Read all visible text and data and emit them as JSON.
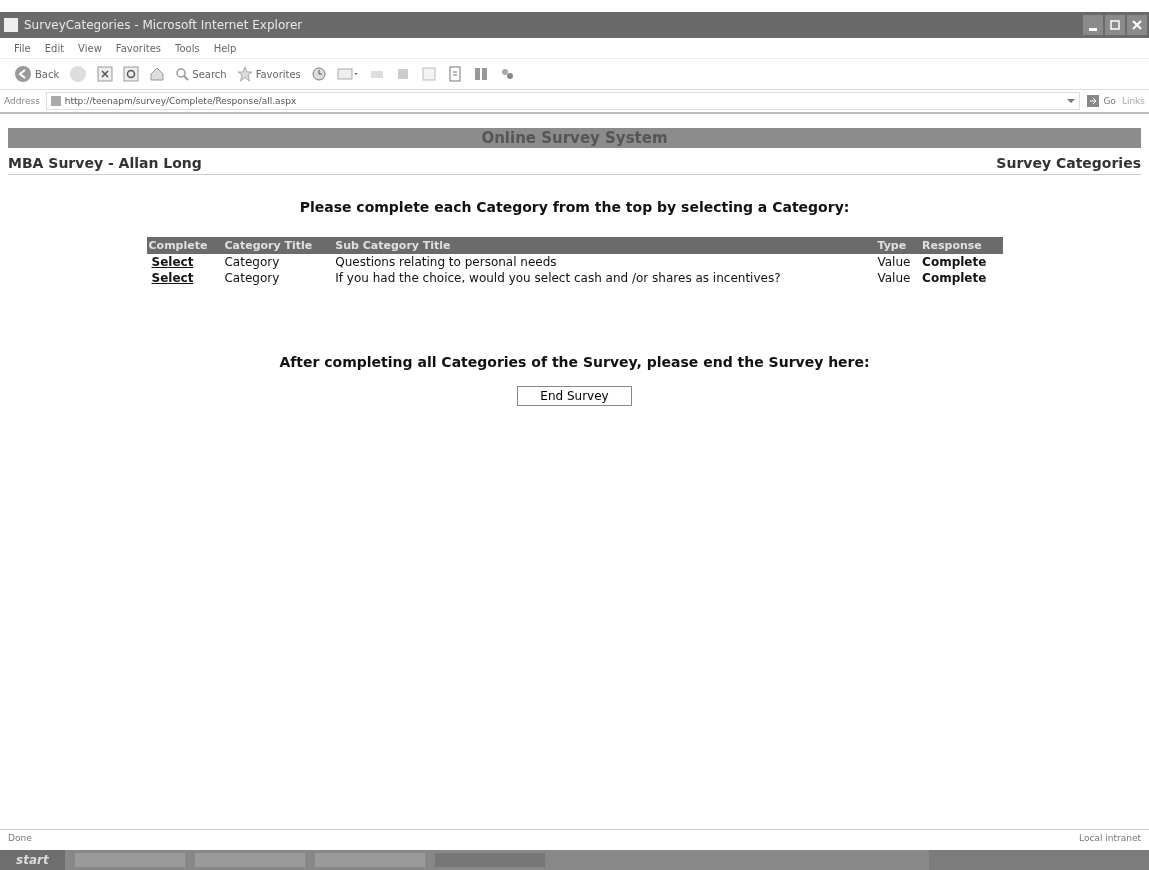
{
  "window": {
    "title": "SurveyCategories - Microsoft Internet Explorer"
  },
  "menu": [
    "File",
    "Edit",
    "View",
    "Favorites",
    "Tools",
    "Help"
  ],
  "toolbar": {
    "back": "Back",
    "search": "Search",
    "favorites": "Favorites"
  },
  "address_bar": {
    "label": "Address",
    "value": "http://teenapm/survey/Complete/Response/all.aspx",
    "go": "Go",
    "links": "Links"
  },
  "page": {
    "banner": "Online Survey System",
    "survey_title": "MBA Survey - Allan Long",
    "section": "Survey Categories",
    "instruction": "Please complete each Category from the top by selecting a Category:",
    "table": {
      "columns": [
        "Complete",
        "Category Title",
        "Sub Category Title",
        "Type",
        "Response"
      ],
      "rows": [
        {
          "link": "Select",
          "category": "Category",
          "sub_category": "Questions relating to personal needs",
          "type": "Value",
          "response": "Complete"
        },
        {
          "link": "Select",
          "category": "Category",
          "sub_category": "If you had the choice, would you select cash and /or shares as incentives?",
          "type": "Value",
          "response": "Complete"
        }
      ]
    },
    "end_instruction": "After completing all Categories of the Survey, please end the Survey here:",
    "end_button": "End Survey"
  },
  "status_bar": {
    "status": "Done",
    "zone": "Local intranet"
  },
  "taskbar": {
    "start": "start"
  }
}
